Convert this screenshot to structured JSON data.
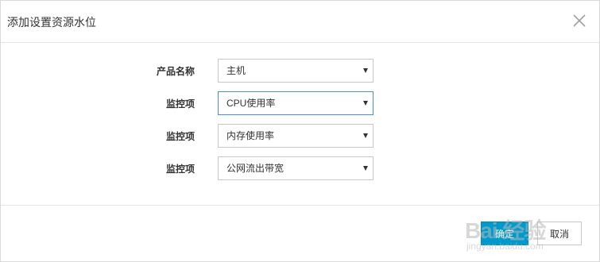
{
  "dialog": {
    "title": "添加设置资源水位"
  },
  "form": {
    "rows": [
      {
        "label": "产品名称",
        "value": "主机"
      },
      {
        "label": "监控项",
        "value": "CPU使用率"
      },
      {
        "label": "监控项",
        "value": "内存使用率"
      },
      {
        "label": "监控项",
        "value": "公网流出带宽"
      }
    ]
  },
  "footer": {
    "confirm_label": "确定",
    "cancel_label": "取消"
  },
  "watermark": {
    "brand": "Bai 经验",
    "url": "jingyan.baidu.com"
  },
  "colors": {
    "primary": "#0099cc",
    "focus_border": "#4a90d6"
  },
  "icons": {
    "close": "close-icon",
    "caret": "chevron-down-icon"
  }
}
